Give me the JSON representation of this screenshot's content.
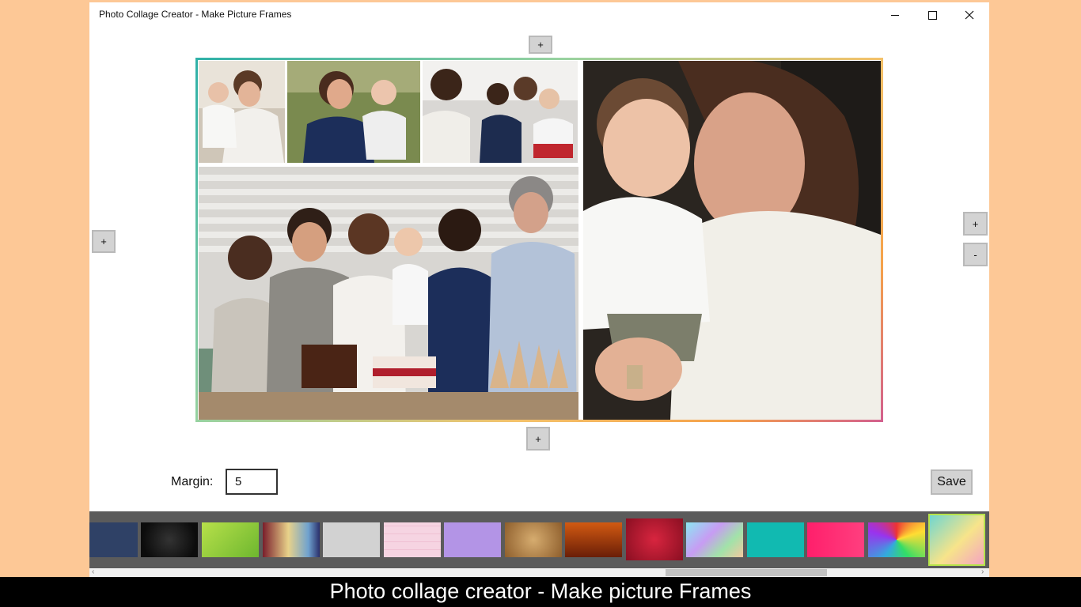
{
  "window": {
    "title": "Photo Collage Creator - Make Picture Frames",
    "controls": {
      "minimize": "—",
      "maximize": "☐",
      "close": "✕"
    }
  },
  "buttons": {
    "add_top": "+",
    "add_left": "+",
    "add_right": "+",
    "remove_right": "-",
    "add_bottom": "+",
    "save": "Save"
  },
  "margin": {
    "label": "Margin:",
    "value": "5"
  },
  "backgrounds": [
    {
      "name": "dark-blue",
      "color": "#2f4166"
    },
    {
      "name": "black",
      "color": "#151515"
    },
    {
      "name": "green",
      "color": "#8fcf3a"
    },
    {
      "name": "rainbow-blur",
      "color": "#c9a25a"
    },
    {
      "name": "light-gray",
      "color": "#d2d2d2"
    },
    {
      "name": "pink-brick",
      "color": "#f6d4e2"
    },
    {
      "name": "lavender",
      "color": "#b394e6"
    },
    {
      "name": "wood",
      "color": "#b98b52"
    },
    {
      "name": "orange-brown",
      "color": "#9c3a10"
    },
    {
      "name": "red-glitter",
      "color": "#b21533"
    },
    {
      "name": "pastel-rainbow",
      "color": "#9ab8ee"
    },
    {
      "name": "teal",
      "color": "#11bab1"
    },
    {
      "name": "hot-pink",
      "color": "#ff1f6b"
    },
    {
      "name": "color-swirl",
      "color": "#6b6b6b"
    },
    {
      "name": "pastel-gradient",
      "color": "#8fd3c8",
      "selected": true
    }
  ],
  "caption": "Photo collage creator - Make picture Frames"
}
